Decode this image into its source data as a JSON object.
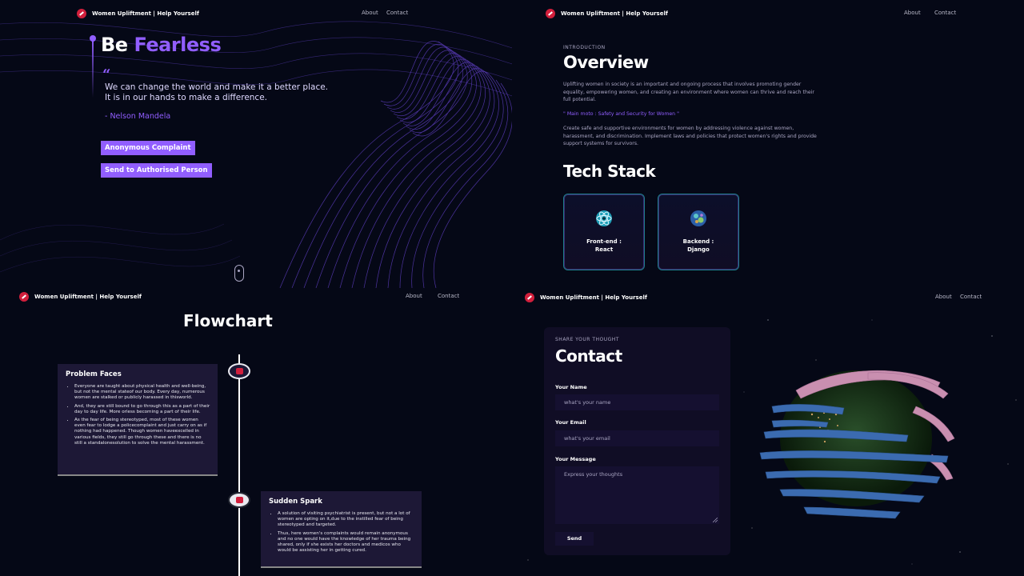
{
  "nav": {
    "brand": "Women Upliftment | Help Yourself",
    "about": "About",
    "contact": "Contact"
  },
  "hero": {
    "title_plain": "Be",
    "title_accent": "Fearless",
    "quote_mark": "“",
    "quote_line1": "We can change the world and make it a better place.",
    "quote_line2": "It is in our hands to make a difference.",
    "author": "- Nelson Mandela",
    "btn_complaint": "Anonymous Complaint",
    "btn_send": "Send to Authorised Person"
  },
  "overview": {
    "subtitle": "INTRODUCTION",
    "title": "Overview",
    "para1": "Uplifting women in society is an important and ongoing process that involves promoting gender equality, empowering women, and creating an environment where women can thrive and reach their full potential.",
    "moto": "\" Main moto : Safety and Security for Women \"",
    "para2": "Create safe and supportive environments for women by addressing violence against women, harassment, and discrimination. Implement laws and policies that protect women's rights and provide support systems for survivors.",
    "tech_title": "Tech Stack",
    "cards": [
      {
        "line1": "Front-end :",
        "line2": "React",
        "icon": "react-icon"
      },
      {
        "line1": "Backend :",
        "line2": "Django",
        "icon": "django-icon"
      }
    ]
  },
  "flowchart": {
    "title": "Flowchart",
    "cards": [
      {
        "title": "Problem Faces",
        "points": [
          "Everyone are taught about physical health and well-being, but not the mental stateof our body. Every day, numerous women are stalked or publicly harassed in thisworld.",
          "And, they are still bound to go through this as a part of their day to day life. More orless becoming a part of their life.",
          "As the fear of being stereotyped, most of these women even fear to lodge a policecomplaint and just carry on as if nothing had happened. Though women haveexcelled in various fields, they still go through these and there is no still a standalonesolution to solve the mental harassment."
        ]
      },
      {
        "title": "Sudden Spark",
        "points": [
          "A solution of visiting psychiatrist is present, but not a lot of women are opting on it,due to the instilled fear of being stereotyped and targeted.",
          "Thus, here women's complaints would remain anonymous and no one would have the knowledge of her trauma being shared, only if she exists her doctors and medicos who would be assisting her in getting cured."
        ]
      }
    ]
  },
  "contact": {
    "subtitle": "SHARE YOUR THOUGHT",
    "title": "Contact",
    "name_label": "Your Name",
    "name_placeholder": "what's your name",
    "email_label": "Your Email",
    "email_placeholder": "what's your email",
    "message_label": "Your Message",
    "message_placeholder": "Express your thoughts",
    "send": "Send"
  },
  "colors": {
    "background": "#050816",
    "accent": "#915eff",
    "card": "#100d25",
    "input": "#151030",
    "logo": "#d21f3c"
  }
}
